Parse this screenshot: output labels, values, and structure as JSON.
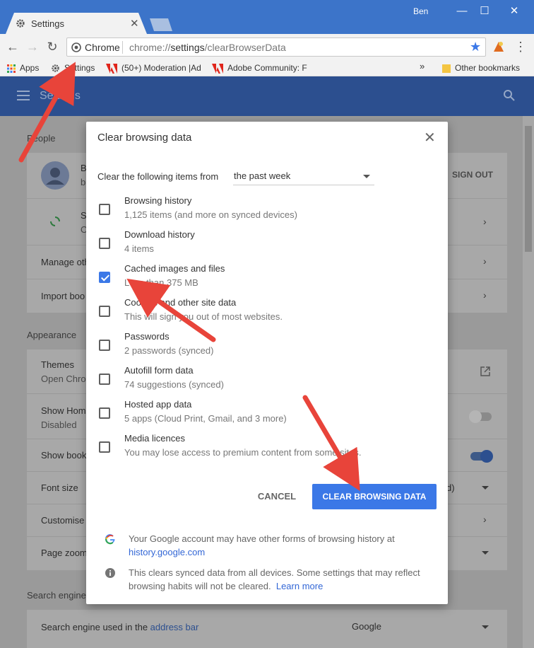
{
  "window": {
    "user": "Ben",
    "minimize": "—",
    "maximize": "☐",
    "close": "✕"
  },
  "tab": {
    "title": "Settings",
    "close": "✕"
  },
  "toolbar": {
    "back": "←",
    "forward": "→",
    "reload": "↻",
    "chip": "Chrome",
    "url_prefix": "chrome://",
    "url_host": "settings",
    "url_path": "/clearBrowserData",
    "star": "★",
    "menu": "⋮"
  },
  "bookmarks": {
    "items": [
      {
        "label": "Apps",
        "icon": "apps-grid-icon"
      },
      {
        "label": "Settings",
        "icon": "gear-icon"
      },
      {
        "label": "(50+) Moderation |Ad",
        "icon": "adobe-icon"
      },
      {
        "label": "Adobe Community: F",
        "icon": "adobe-icon"
      }
    ],
    "more": "»",
    "other": "Other bookmarks"
  },
  "settings": {
    "title": "Settings",
    "people_title": "People",
    "account_initial": "B",
    "account_sub": "b",
    "sign_out": "SIGN OUT",
    "sync_initial": "S",
    "sync_sub": "O",
    "manage": "Manage oth",
    "import": "Import boo",
    "appearance_title": "Appearance",
    "themes": "Themes",
    "themes_sub": "Open Chrom",
    "show_home": "Show Hom",
    "show_home_sub": "Disabled",
    "show_bookmarks": "Show book",
    "font_size": "Font size",
    "font_size_value": "d)",
    "customise": "Customise",
    "page_zoom": "Page zoom",
    "search_title": "Search engine",
    "search_engine_label": "Search engine used in the ",
    "search_engine_link": "address bar",
    "search_engine_value": "Google"
  },
  "modal": {
    "title": "Clear browsing data",
    "close": "✕",
    "range_label": "Clear the following items from",
    "range_value": "the past week",
    "options": [
      {
        "label": "Browsing history",
        "sub": "1,125 items (and more on synced devices)",
        "checked": false
      },
      {
        "label": "Download history",
        "sub": "4 items",
        "checked": false
      },
      {
        "label": "Cached images and files",
        "sub": "Less than 375 MB",
        "checked": true
      },
      {
        "label": "Cookies and other site data",
        "sub": "This will sign you out of most websites.",
        "checked": false
      },
      {
        "label": "Passwords",
        "sub": "2 passwords (synced)",
        "checked": false
      },
      {
        "label": "Autofill form data",
        "sub": "74 suggestions (synced)",
        "checked": false
      },
      {
        "label": "Hosted app data",
        "sub": "5 apps (Cloud Print, Gmail, and 3 more)",
        "checked": false
      },
      {
        "label": "Media licences",
        "sub": "You may lose access to premium content from some sites.",
        "checked": false
      }
    ],
    "cancel": "CANCEL",
    "clear": "CLEAR BROWSING DATA",
    "google_note": "Your Google account may have other forms of browsing history at",
    "google_link": "history.google.com",
    "info_note": "This clears synced data from all devices. Some settings that may reflect browsing habits will not be cleared.",
    "learn_more": "Learn more"
  },
  "colors": {
    "accent": "#3b78e7",
    "header": "#2c4f8f",
    "arrow": "#e8443a"
  }
}
